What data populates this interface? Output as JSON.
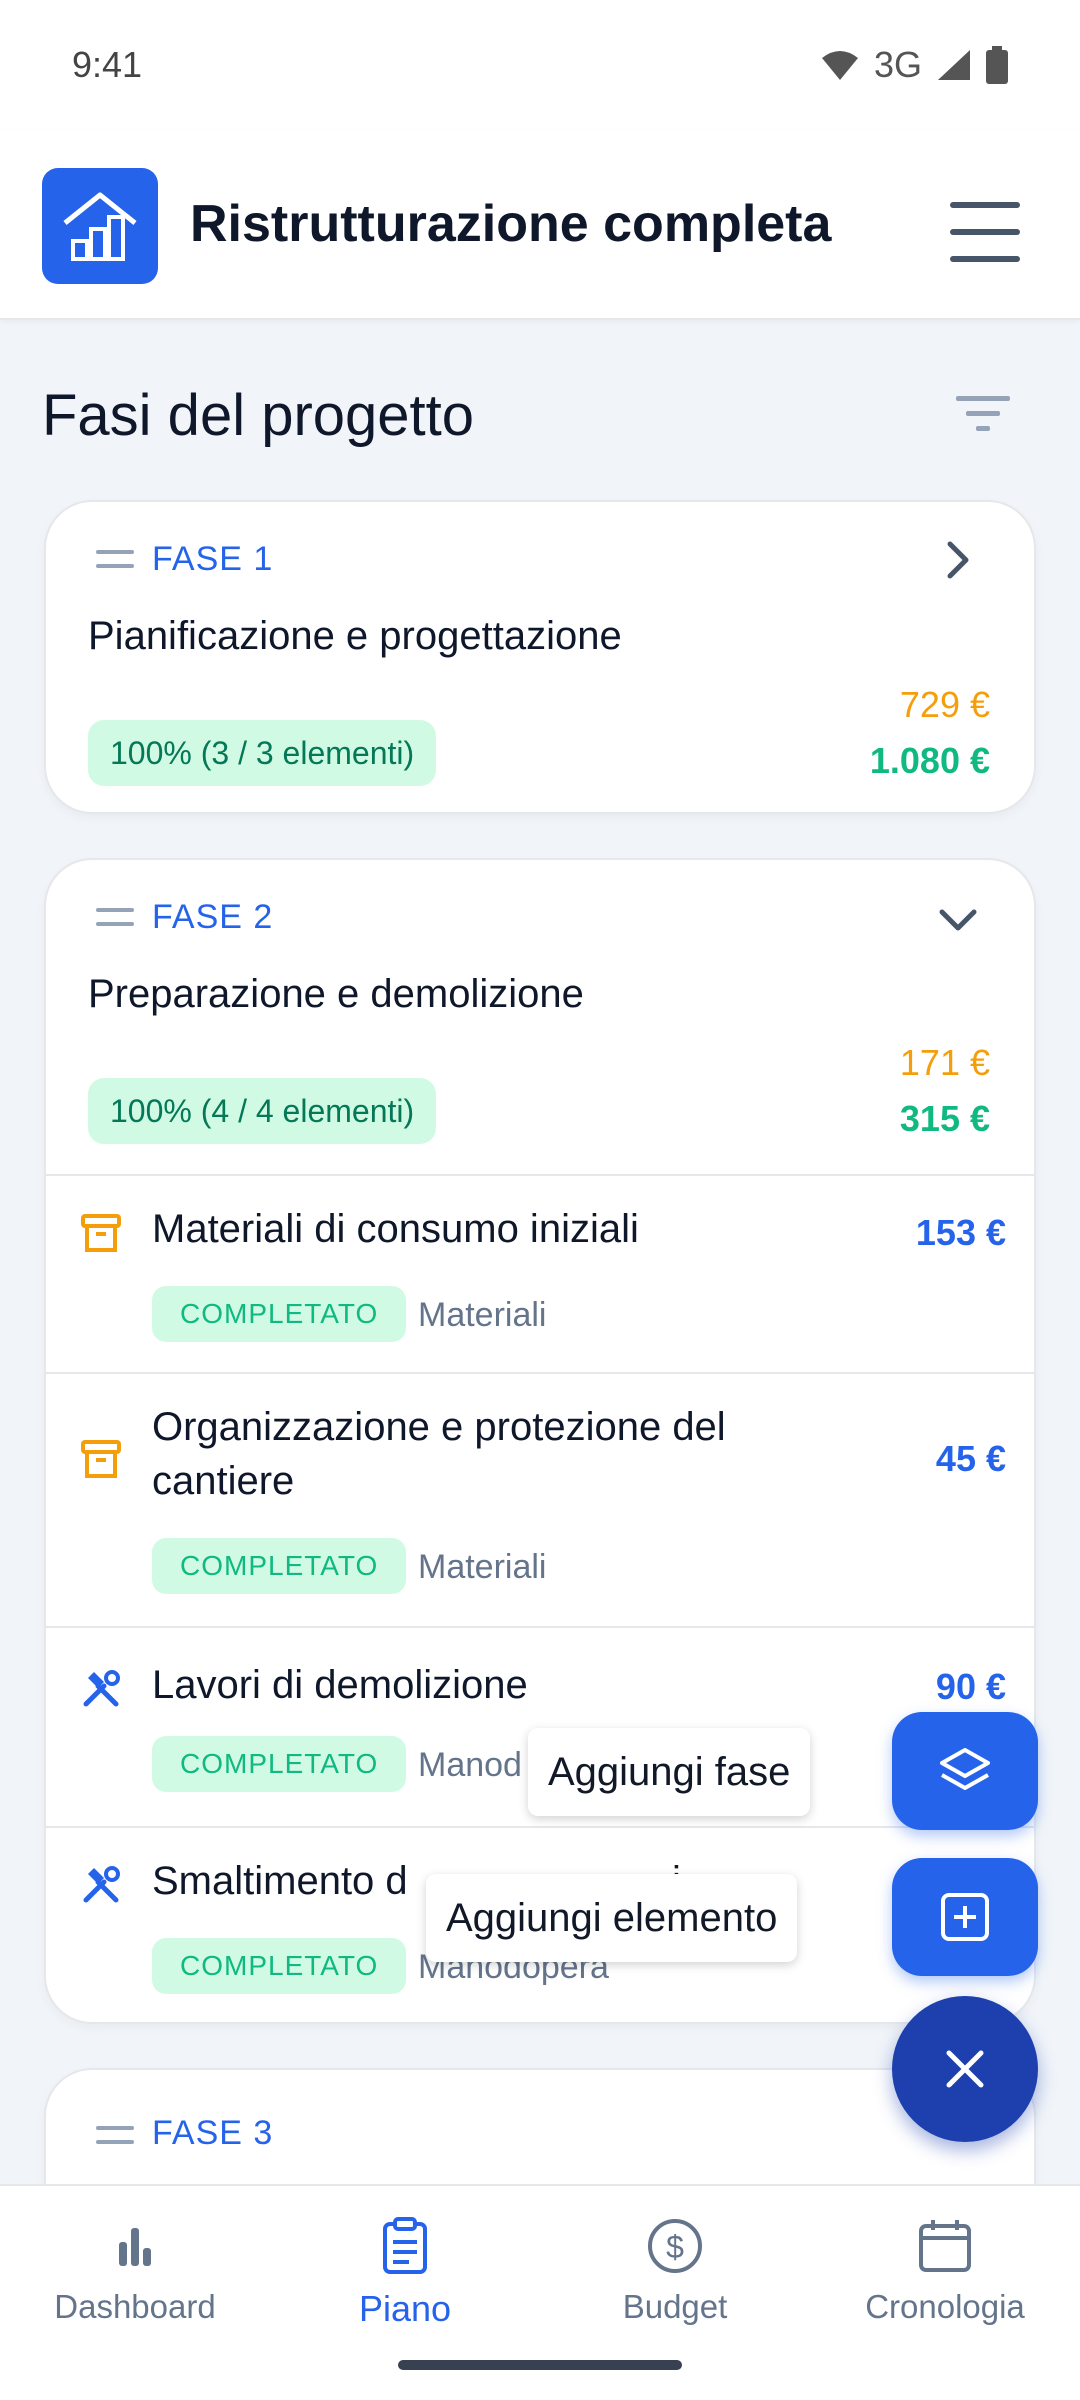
{
  "status": {
    "time": "9:41",
    "network": "3G"
  },
  "app": {
    "title": "Ristrutturazione completa",
    "logo_icon": "house-chart-icon",
    "menu_icon": "menu-icon"
  },
  "section": {
    "title": "Fasi del progetto",
    "filter_icon": "filter-icon"
  },
  "phases": [
    {
      "label": "FASE 1",
      "name": "Pianificazione e progettazione",
      "progress": "100% (3 / 3 elementi)",
      "planned": "729 €",
      "actual": "1.080 €",
      "expanded": false
    },
    {
      "label": "FASE 2",
      "name": "Preparazione e demolizione",
      "progress": "100% (4 / 4 elementi)",
      "planned": "171 €",
      "actual": "315 €",
      "expanded": true,
      "items": [
        {
          "title": "Materiali di consumo iniziali",
          "amount": "153 €",
          "status": "COMPLETATO",
          "category": "Materiali",
          "icon": "archive-box-icon"
        },
        {
          "title_line1": "Organizzazione e protezione del",
          "title_line2": "cantiere",
          "amount": "45 €",
          "status": "COMPLETATO",
          "category": "Materiali",
          "icon": "archive-box-icon"
        },
        {
          "title": "Lavori di demolizione",
          "amount": "90 €",
          "status": "COMPLETATO",
          "category": "Manod",
          "icon": "tools-icon"
        },
        {
          "title": "Smaltimento d",
          "title_tail": "i",
          "status": "COMPLETATO",
          "category": "Manodopera",
          "icon": "tools-icon"
        }
      ]
    },
    {
      "label": "FASE 3"
    }
  ],
  "fab": {
    "add_phase_label": "Aggiungi fase",
    "add_item_label": "Aggiungi elemento",
    "close_icon": "close-icon"
  },
  "nav": [
    {
      "label": "Dashboard",
      "icon": "bar-chart-icon",
      "active": false
    },
    {
      "label": "Piano",
      "icon": "clipboard-icon",
      "active": true
    },
    {
      "label": "Budget",
      "icon": "dollar-circle-icon",
      "active": false
    },
    {
      "label": "Cronologia",
      "icon": "calendar-icon",
      "active": false
    }
  ],
  "colors": {
    "primary": "#2563eb",
    "fab_dark": "#1e40af",
    "planned": "#f59e0b",
    "actual": "#10b981",
    "badge_bg": "#d1fae5"
  }
}
